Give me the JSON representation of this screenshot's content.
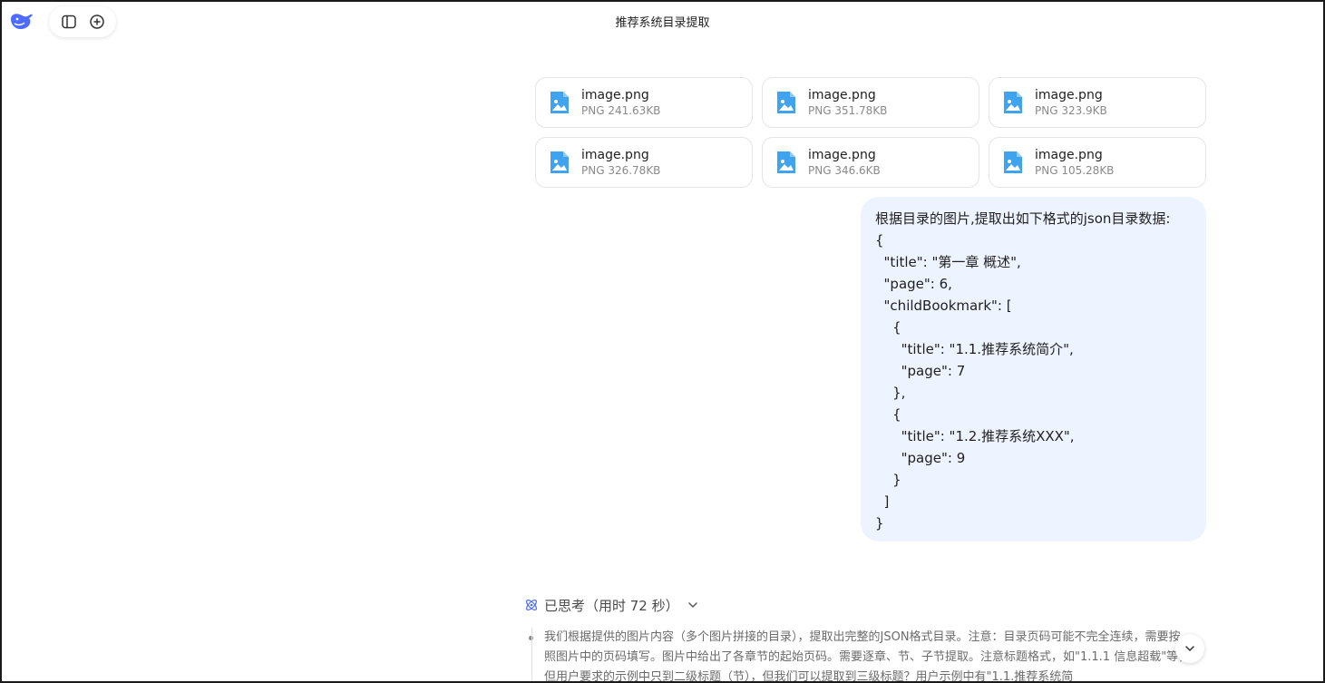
{
  "header": {
    "title": "推荐系统目录提取"
  },
  "files": [
    {
      "name": "image.png",
      "meta": "PNG 241.63KB"
    },
    {
      "name": "image.png",
      "meta": "PNG 351.78KB"
    },
    {
      "name": "image.png",
      "meta": "PNG 323.9KB"
    },
    {
      "name": "image.png",
      "meta": "PNG 326.78KB"
    },
    {
      "name": "image.png",
      "meta": "PNG 346.6KB"
    },
    {
      "name": "image.png",
      "meta": "PNG 105.28KB"
    }
  ],
  "user_message": "根据目录的图片,提取出如下格式的json目录数据:\n{\n  \"title\": \"第一章 概述\",\n  \"page\": 6,\n  \"childBookmark\": [\n    {\n      \"title\": \"1.1.推荐系统简介\",\n      \"page\": 7\n    },\n    {\n      \"title\": \"1.2.推荐系统XXX\",\n      \"page\": 9\n    }\n  ]\n}",
  "thinking": {
    "label": "已思考（用时 72 秒）",
    "text": "我们根据提供的图片内容（多个图片拼接的目录），提取出完整的JSON格式目录。注意：目录页码可能不完全连续，需要按照图片中的页码填写。图片中给出了各章节的起始页码。需要逐章、节、子节提取。注意标题格式，如\"1.1.1 信息超载\"等，但用户要求的示例中只到二级标题（节），但我们可以提取到三级标题？用户示例中有\"1.1.推荐系统简"
  },
  "colors": {
    "accent": "#4d6bfe",
    "bubble_bg": "#eef4ff",
    "file_icon": "#3fa3f0"
  }
}
